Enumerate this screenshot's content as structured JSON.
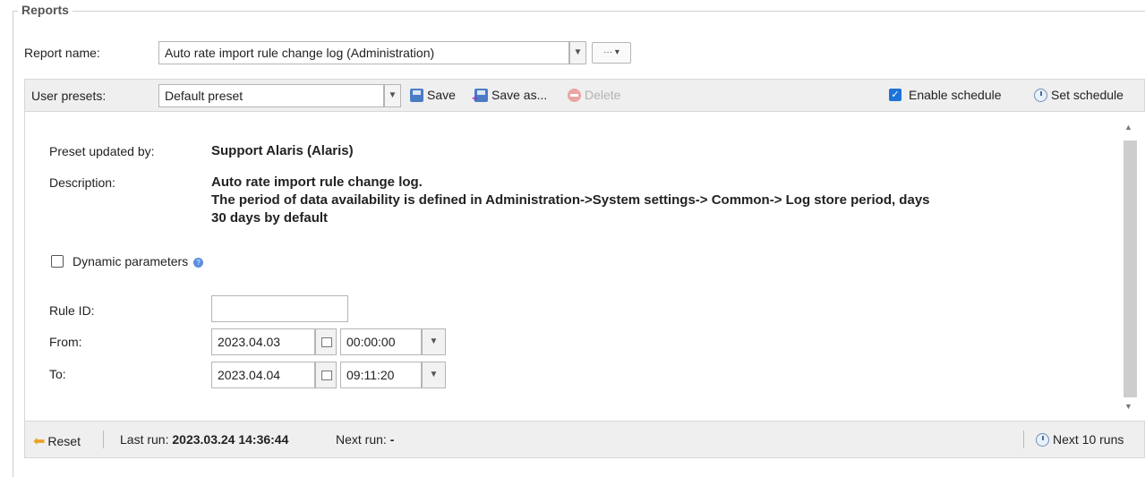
{
  "section": {
    "legend": "Reports"
  },
  "report": {
    "label": "Report name:",
    "selected": "Auto rate import rule change log (Administration)",
    "more_label": "··· ▾"
  },
  "toolbar": {
    "presets_label": "User presets:",
    "preset_selected": "Default preset",
    "save": "Save",
    "save_as": "Save as...",
    "delete": "Delete",
    "enable_schedule": "Enable schedule",
    "enable_schedule_checked": true,
    "set_schedule": "Set schedule"
  },
  "details": {
    "updated_by_label": "Preset updated by:",
    "updated_by_value": "Support Alaris (Alaris)",
    "description_label": "Description:",
    "description_lines": [
      "Auto rate import rule change log.",
      "The period of data availability is defined in Administration->System settings-> Common-> Log store period, days",
      "30 days by default"
    ]
  },
  "dynamic": {
    "label": "Dynamic parameters",
    "checked": false
  },
  "params": {
    "rule_id_label": "Rule ID:",
    "rule_id_value": "",
    "from_label": "From:",
    "from_date": "2023.04.03",
    "from_time": "00:00:00",
    "to_label": "To:",
    "to_date": "2023.04.04",
    "to_time": "09:11:20"
  },
  "footer": {
    "reset": "Reset",
    "last_run_label": "Last run:",
    "last_run_value": "2023.03.24 14:36:44",
    "next_run_label": "Next run:",
    "next_run_value": "-",
    "next_10_runs": "Next 10 runs"
  },
  "colors": {
    "accent": "#1e73d8",
    "toolbar_bg": "#efefef",
    "reset_icon": "#e8a227"
  }
}
